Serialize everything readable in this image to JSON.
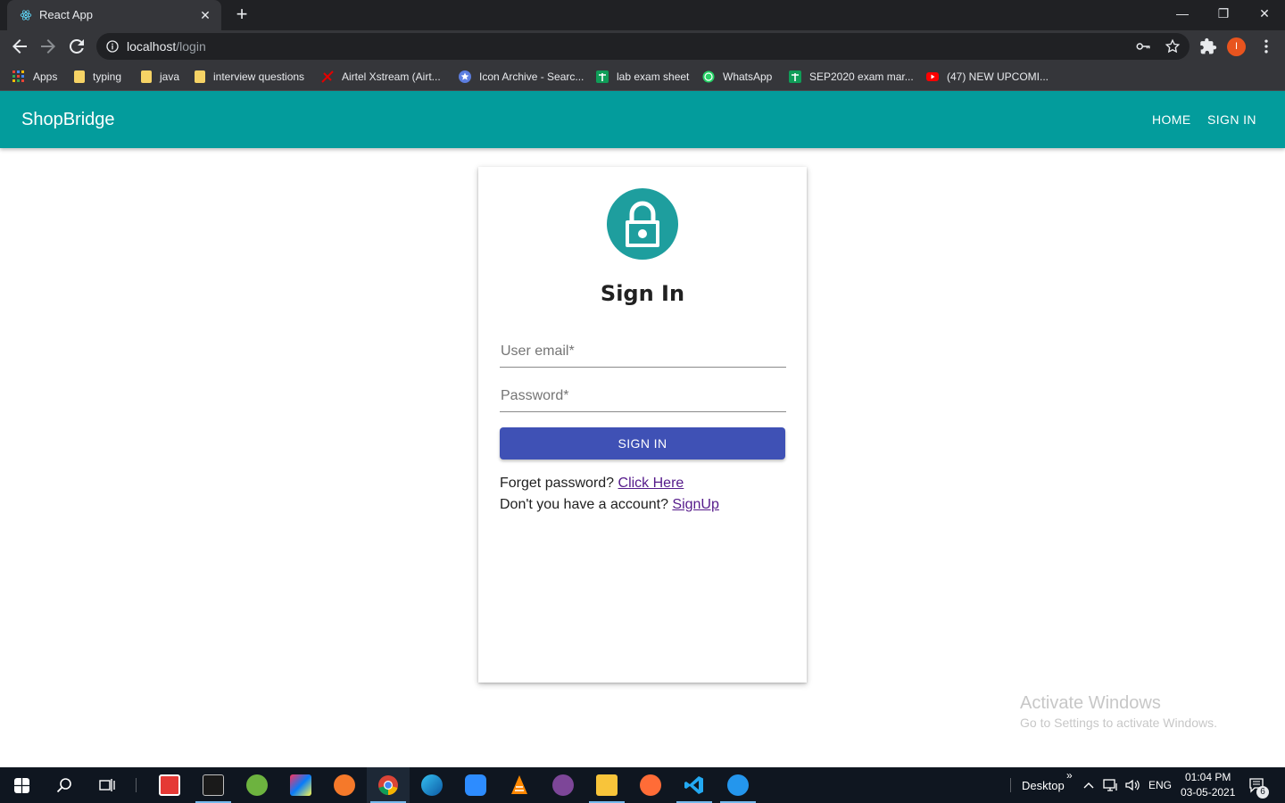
{
  "browser": {
    "tab_title": "React App",
    "tab_close": "✕",
    "new_tab": "+",
    "url_host": "localhost",
    "url_path": "/login",
    "profile_initial": "I",
    "window_controls": {
      "minimize": "—",
      "restore": "❐",
      "close": "✕"
    },
    "bookmarks": [
      {
        "label": "Apps",
        "icon": "apps-grid-icon"
      },
      {
        "label": "typing",
        "icon": "folder-icon"
      },
      {
        "label": "java",
        "icon": "folder-icon"
      },
      {
        "label": "interview questions",
        "icon": "folder-icon"
      },
      {
        "label": "Airtel Xstream (Airt...",
        "icon": "airtel-icon"
      },
      {
        "label": "Icon Archive - Searc...",
        "icon": "icon-archive-icon"
      },
      {
        "label": "lab exam sheet",
        "icon": "sheets-icon"
      },
      {
        "label": "WhatsApp",
        "icon": "whatsapp-icon"
      },
      {
        "label": "SEP2020 exam mar...",
        "icon": "sheets-icon"
      },
      {
        "label": "(47) NEW UPCOMI...",
        "icon": "youtube-icon"
      }
    ]
  },
  "app": {
    "brand": "ShopBridge",
    "nav": {
      "home": "HOME",
      "signin": "SIGN IN"
    },
    "form": {
      "title": "Sign In",
      "email_label": "User email*",
      "password_label": "Password*",
      "submit_label": "SIGN IN",
      "forgot_text": "Forget password? ",
      "forgot_link": "Click Here",
      "signup_text": "Don't you have a account? ",
      "signup_link": "SignUp"
    }
  },
  "watermark": {
    "line1": "Activate Windows",
    "line2": "Go to Settings to activate Windows."
  },
  "taskbar": {
    "desktop_label": "Desktop",
    "chevron": "»",
    "language": "ENG",
    "time": "01:04 PM",
    "date": "03-05-2021",
    "notification_count": "6",
    "apps": [
      "windows-start-icon",
      "search-icon",
      "task-view-icon",
      "power-app-icon",
      "terminal-icon",
      "spring-icon",
      "intellij-icon",
      "blender-icon",
      "chrome-icon",
      "edge-icon",
      "zoom-icon",
      "vlc-icon",
      "tor-icon",
      "file-explorer-icon",
      "postman-icon",
      "vscode-icon",
      "docker-icon"
    ],
    "colors": {
      "accent": "#76b9ed",
      "background": "#0f1620"
    }
  },
  "colors": {
    "appbar": "#039c9c",
    "avatar": "#1e9e9e",
    "primary_button": "#3f51b5",
    "link": "#551a8b"
  }
}
